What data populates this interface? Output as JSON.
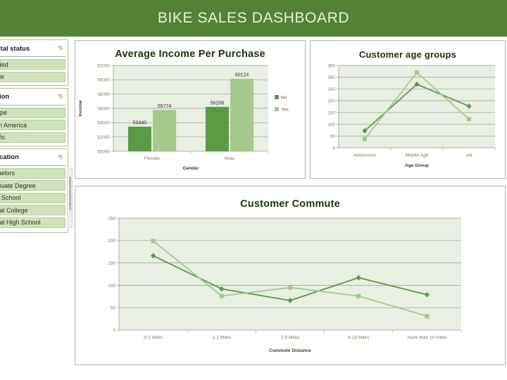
{
  "header": {
    "title": "BIKE SALES DASHBOARD",
    "bg_color": "#548235",
    "text_color": "#e8f2de"
  },
  "theme": {
    "series_dark": "#599b43",
    "series_light": "#a4c98a",
    "plot_bg": "#e9efe3",
    "gridline": "#9a9a9a",
    "slicer_item_bg": "#cfe3bb",
    "slicer_border": "#a9c48e"
  },
  "sidebar": {
    "slicers": [
      {
        "title": "Marital status",
        "clear_icon": "clear-filter-funnel-icon",
        "items": [
          "Married",
          "Single"
        ],
        "has_scrollbar": false
      },
      {
        "title": "Region",
        "clear_icon": "clear-filter-funnel-icon",
        "items": [
          "Europe",
          "North America",
          "Pacific"
        ],
        "has_scrollbar": false
      },
      {
        "title": "Education",
        "clear_icon": "clear-filter-funnel-icon",
        "items": [
          "Bachelors",
          "Graduate Degree",
          "High School",
          "Partial College",
          "Partial High School"
        ],
        "has_scrollbar": true
      }
    ]
  },
  "charts": {
    "income": {
      "title": "Average Income Per Purchase"
    },
    "age": {
      "title": "Customer age groups"
    },
    "commute": {
      "title": "Customer Commute"
    }
  },
  "chart_data": [
    {
      "id": "income",
      "type": "bar",
      "title": "Average Income Per Purchase",
      "xlabel": "Gender",
      "ylabel": "Income",
      "categories": [
        "Female",
        "Male"
      ],
      "ylim": [
        50000,
        62000
      ],
      "yticks": [
        50000,
        52000,
        54000,
        56000,
        58000,
        60000,
        62000
      ],
      "grid": true,
      "legend_position": "right",
      "data_labels": true,
      "series": [
        {
          "name": "No",
          "color": "#599b43",
          "values": [
            53440,
            56208
          ]
        },
        {
          "name": "Yes",
          "color": "#a4c98a",
          "values": [
            55774,
            60124
          ]
        }
      ]
    },
    {
      "id": "age",
      "type": "line",
      "title": "Customer age groups",
      "xlabel": "Age Group",
      "ylabel": "",
      "categories": [
        "Adolescent",
        "Middle Age",
        "old"
      ],
      "ylim": [
        0,
        350
      ],
      "yticks": [
        0,
        50,
        100,
        150,
        200,
        250,
        300,
        350
      ],
      "grid": true,
      "legend_position": "none",
      "data_labels": false,
      "series": [
        {
          "name": "No",
          "color": "#599b43",
          "marker": "diamond",
          "values": [
            72,
            270,
            177
          ]
        },
        {
          "name": "Yes",
          "color": "#a4c98a",
          "marker": "square",
          "values": [
            37,
            320,
            122
          ]
        }
      ]
    },
    {
      "id": "commute",
      "type": "line",
      "title": "Customer Commute",
      "xlabel": "Commute  Distance",
      "ylabel": "",
      "categories": [
        "0-1 Miles",
        "1-2 Miles",
        "2-5 Miles",
        "5-10 Miles",
        "more than 10 miles"
      ],
      "ylim": [
        0,
        250
      ],
      "yticks": [
        0,
        50,
        100,
        150,
        200,
        250
      ],
      "grid": true,
      "legend_position": "none",
      "data_labels": false,
      "series": [
        {
          "name": "No",
          "color": "#599b43",
          "marker": "diamond",
          "values": [
            166,
            92,
            66,
            117,
            79
          ]
        },
        {
          "name": "Yes",
          "color": "#a4c98a",
          "marker": "square",
          "values": [
            199,
            76,
            95,
            76,
            31
          ]
        }
      ]
    }
  ]
}
